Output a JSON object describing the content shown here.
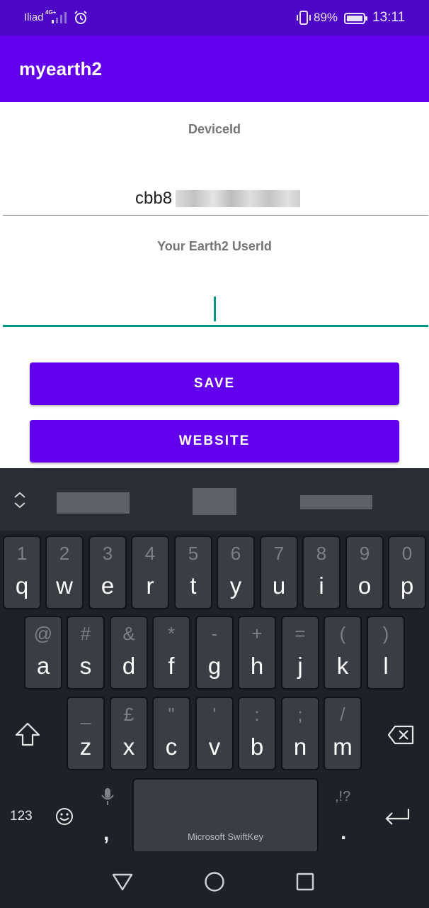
{
  "status_bar": {
    "carrier": "Iliad",
    "network": "4G+",
    "battery_percent": "89%",
    "time": "13:11",
    "icons": [
      "signal-icon",
      "alarm-icon",
      "vibrate-icon",
      "battery-icon"
    ]
  },
  "app_bar": {
    "title": "myearth2"
  },
  "form": {
    "device_label": "DeviceId",
    "device_value": "cbb8",
    "userid_label": "Your Earth2 UserId",
    "userid_value": ""
  },
  "buttons": {
    "save": "SAVE",
    "website": "WEBSITE"
  },
  "keyboard": {
    "row1": [
      {
        "hint": "1",
        "key": "q"
      },
      {
        "hint": "2",
        "key": "w"
      },
      {
        "hint": "3",
        "key": "e"
      },
      {
        "hint": "4",
        "key": "r"
      },
      {
        "hint": "5",
        "key": "t"
      },
      {
        "hint": "6",
        "key": "y"
      },
      {
        "hint": "7",
        "key": "u"
      },
      {
        "hint": "8",
        "key": "i"
      },
      {
        "hint": "9",
        "key": "o"
      },
      {
        "hint": "0",
        "key": "p"
      }
    ],
    "row2": [
      {
        "hint": "@",
        "key": "a"
      },
      {
        "hint": "#",
        "key": "s"
      },
      {
        "hint": "&",
        "key": "d"
      },
      {
        "hint": "*",
        "key": "f"
      },
      {
        "hint": "-",
        "key": "g"
      },
      {
        "hint": "+",
        "key": "h"
      },
      {
        "hint": "=",
        "key": "j"
      },
      {
        "hint": "(",
        "key": "k"
      },
      {
        "hint": ")",
        "key": "l"
      }
    ],
    "row3": [
      {
        "hint": "_",
        "key": "z"
      },
      {
        "hint": "£",
        "key": "x"
      },
      {
        "hint": "\"",
        "key": "c"
      },
      {
        "hint": "'",
        "key": "v"
      },
      {
        "hint": ":",
        "key": "b"
      },
      {
        "hint": ";",
        "key": "n"
      },
      {
        "hint": "/",
        "key": "m"
      }
    ],
    "numbers_key": "123",
    "comma_key": ",",
    "period_key": ".",
    "period_hint": ",!?",
    "space_brand": "Microsoft SwiftKey",
    "colors": {
      "background": "#1e2127",
      "key": "#3a3d43",
      "hint": "#7d8087"
    }
  },
  "accent": {
    "primary": "#6200ee",
    "status": "#4d06c6",
    "cursor": "#009688"
  }
}
